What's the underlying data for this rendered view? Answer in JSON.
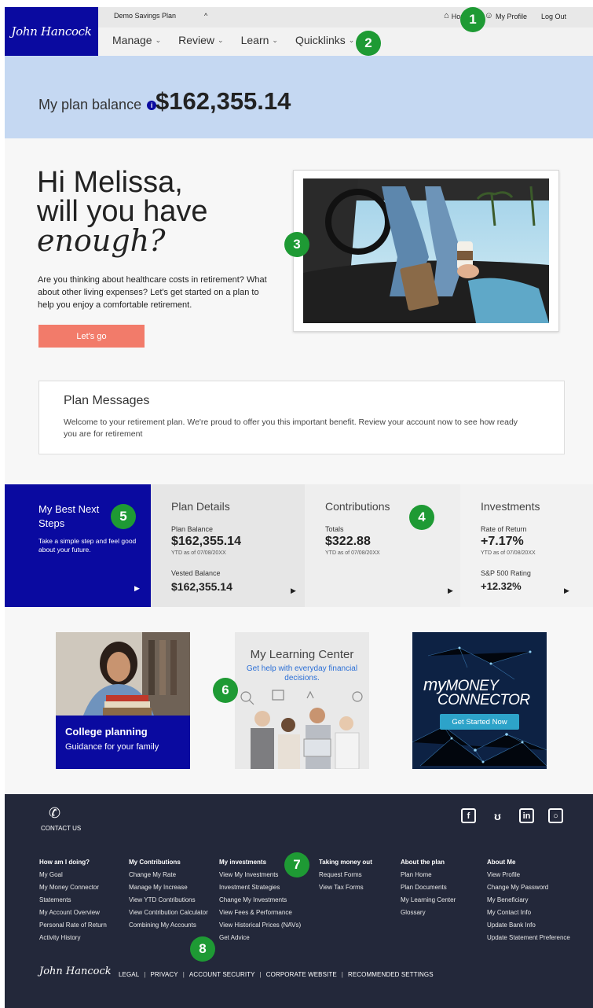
{
  "header": {
    "logo": "John Hancock",
    "plan_name": "Demo Savings Plan",
    "plan_chevron": "^",
    "top_links": {
      "home": "Home",
      "profile": "My Profile",
      "logout": "Log Out"
    },
    "nav": [
      {
        "label": "Manage"
      },
      {
        "label": "Review"
      },
      {
        "label": "Learn"
      },
      {
        "label": "Quicklinks"
      }
    ]
  },
  "badges": [
    "1",
    "2",
    "3",
    "4",
    "5",
    "6",
    "7",
    "8"
  ],
  "balance": {
    "label": "My plan balance",
    "info": "i",
    "value": "$162,355.14"
  },
  "hero": {
    "line1": "Hi Melissa,",
    "line2": "will you have",
    "line3": "enough?",
    "body": "Are you thinking about healthcare costs in retirement? What about other living expenses? Let's get started on a plan to help you enjoy a comfortable retirement.",
    "cta": "Let's go"
  },
  "messages": {
    "title": "Plan Messages",
    "body": "Welcome to your retirement plan. We're proud to offer you this important benefit. Review your account now to see how ready you are for retirement"
  },
  "tiles": {
    "next": {
      "title": "My Best Next Steps",
      "desc": "Take a simple step and feel good about your future."
    },
    "plan": {
      "title": "Plan Details",
      "balance_label": "Plan Balance",
      "balance_value": "$162,355.14",
      "balance_sub": "YTD as of 07/08/20XX",
      "vested_label": "Vested Balance",
      "vested_value": "$162,355.14"
    },
    "contributions": {
      "title": "Contributions",
      "totals_label": "Totals",
      "totals_value": "$322.88",
      "totals_sub": "YTD as of 07/08/20XX"
    },
    "investments": {
      "title": "Investments",
      "ror_label": "Rate of Return",
      "ror_value": "+7.17%",
      "ror_sub": "YTD as of 07/08/20XX",
      "sp_label": "S&P 500 Rating",
      "sp_value": "+12.32%"
    }
  },
  "promos": {
    "college": {
      "title": "College planning",
      "sub": "Guidance for your family"
    },
    "learning": {
      "title": "My Learning Center",
      "sub": "Get help with everyday financial decisions."
    },
    "money": {
      "title_my": "my",
      "title_money": "MONEY",
      "title_connector": "CONNECTOR",
      "button": "Get Started Now"
    }
  },
  "footer": {
    "contact": "CONTACT US",
    "columns": [
      {
        "heading": "How am I doing?",
        "links": [
          "My Goal",
          "My Money Connector",
          "Statements",
          "My Account Overview",
          "Personal Rate of Return",
          "Activity History"
        ]
      },
      {
        "heading": "My Contributions",
        "links": [
          "Change My Rate",
          "Manage My Increase",
          "View YTD Contributions",
          "View Contribution Calculator",
          "Combining My Accounts"
        ]
      },
      {
        "heading": "My investments",
        "links": [
          "View My Investments",
          "Investment Strategies",
          "Change My Investments",
          "View Fees & Performance",
          "View Historical Prices (NAVs)",
          "Get Advice"
        ]
      },
      {
        "heading": "Taking money out",
        "links": [
          "Request Forms",
          "View Tax Forms"
        ]
      },
      {
        "heading": "About the plan",
        "links": [
          "Plan Home",
          "Plan Documents",
          "My Learning Center",
          "Glossary"
        ]
      },
      {
        "heading": "About Me",
        "links": [
          "View Profile",
          "Change My Password",
          "My Beneficiary",
          "My Contact Info",
          "Update Bank Info",
          "Update Statement Preference"
        ]
      }
    ],
    "logo": "John Hancock",
    "legal": [
      "LEGAL",
      "PRIVACY",
      "ACCOUNT SECURITY",
      "CORPORATE WEBSITE",
      "RECOMMENDED SETTINGS"
    ],
    "legal_sep": "|"
  },
  "colors": {
    "brand": "#0a0aa0",
    "cta": "#f27b6a",
    "badge": "#1e9a34",
    "balance_band": "#c5d8f2",
    "footer": "#23283a"
  }
}
